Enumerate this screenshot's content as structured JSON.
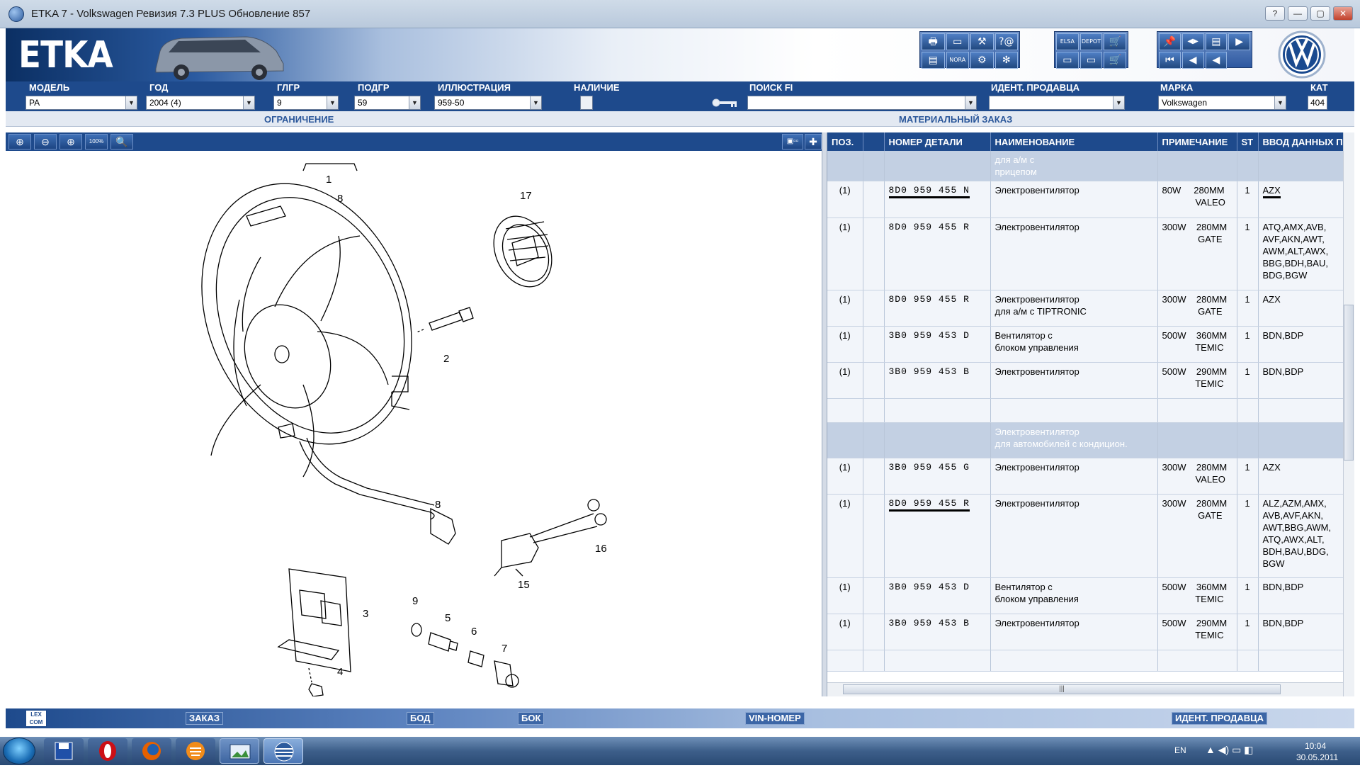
{
  "window": {
    "title": "ETKA 7 - Volkswagen Ревизия 7.3 PLUS Обновление 857",
    "buttons": [
      "?",
      "—",
      "▢",
      "✕"
    ]
  },
  "header": {
    "logo": "ETKA"
  },
  "toolbar_groups": [
    {
      "name": "print-search",
      "labels": [
        "🖶",
        "▭",
        "⚒",
        "?@",
        "▤",
        "NORA",
        "⚙",
        "✻"
      ]
    },
    {
      "name": "elsa-depot",
      "labels": [
        "ELSA",
        "DEPOT",
        "🛒",
        "▭",
        "▭",
        "🛒"
      ]
    },
    {
      "name": "navigation",
      "labels": [
        "📌",
        "◀▶",
        "▤",
        "▶",
        "⏮",
        "◀",
        "◀"
      ]
    }
  ],
  "fields": {
    "model": {
      "label": "МОДЕЛЬ",
      "value": "PA"
    },
    "year": {
      "label": "ГОД",
      "value": "2004 (4)"
    },
    "main_group": {
      "label": "ГЛГР",
      "value": "9"
    },
    "sub_group": {
      "label": "ПОДГР",
      "value": "59"
    },
    "illustration": {
      "label": "ИЛЛЮСТРАЦИЯ",
      "value": "959-50"
    },
    "availability": {
      "label": "НАЛИЧИЕ"
    },
    "search_fi": {
      "label": "ПОИСК FI",
      "value": ""
    },
    "dealer_id": {
      "label": "ИДЕНТ. ПРОДАВЦА",
      "value": ""
    },
    "brand": {
      "label": "МАРКА",
      "value": "Volkswagen"
    },
    "catalog": {
      "label": "КАТ",
      "value": "404"
    }
  },
  "sublabels": {
    "restriction": "ОГРАНИЧЕНИЕ",
    "material_order": "МАТЕРИАЛЬНЫЙ ЗАКАЗ"
  },
  "zoom_buttons": [
    "⊕",
    "⊖",
    "⊕",
    "100%",
    "🔍"
  ],
  "diagram_callouts": [
    "1",
    "8",
    "17",
    "2",
    "8",
    "16",
    "15",
    "3",
    "4",
    "9",
    "5",
    "6",
    "7"
  ],
  "parts_table": {
    "columns": [
      "ПОЗ.",
      "",
      "НОМЕР ДЕТАЛИ",
      "НАИМЕНОВАНИЕ",
      "ПРИМЕЧАНИЕ",
      "ST",
      "ВВОД ДАННЫХ П"
    ],
    "rows": [
      {
        "type": "header",
        "name": "для а/м с\nприцепом"
      },
      {
        "pos": "(1)",
        "part": "8D0  959  455  N",
        "name": "Электровентилятор",
        "note": "80W     280MM\n             VALEO",
        "st": "1",
        "data": "AZX",
        "ul_part": true,
        "ul_data": true
      },
      {
        "pos": "(1)",
        "part": "8D0  959  455  R",
        "name": "Электровентилятор",
        "note": "300W    280MM\n              GATE",
        "st": "1",
        "data": "ATQ,AMX,AVB,\nAVF,AKN,AWT,\nAWM,ALT,AWX,\nBBG,BDH,BAU,\nBDG,BGW"
      },
      {
        "pos": "(1)",
        "part": "8D0  959  455  R",
        "name": "Электровентилятор\nдля а/м с TIPTRONIC",
        "note": "300W    280MM\n              GATE",
        "st": "1",
        "data": "AZX"
      },
      {
        "pos": "(1)",
        "part": "3B0  959  453  D",
        "name": "Вентилятор с\nблоком управления",
        "note": "500W    360MM\n             TEMIC",
        "st": "1",
        "data": "BDN,BDP"
      },
      {
        "pos": "(1)",
        "part": "3B0  959  453  B",
        "name": "Электровентилятор",
        "note": "500W    290MM\n             TEMIC",
        "st": "1",
        "data": "BDN,BDP"
      },
      {
        "type": "empty"
      },
      {
        "type": "header",
        "name": "Электровентилятор\nдля автомобилей с кондицион."
      },
      {
        "pos": "(1)",
        "part": "3B0  959  455  G",
        "name": "Электровентилятор",
        "note": "300W    280MM\n             VALEO",
        "st": "1",
        "data": "AZX"
      },
      {
        "pos": "(1)",
        "part": "8D0  959  455  R",
        "name": "Электровентилятор",
        "note": "300W    280MM\n              GATE",
        "st": "1",
        "data": "ALZ,AZM,AMX,\nAVB,AVF,AKN,\nAWT,BBG,AWM,\nATQ,AWX,ALT,\nBDH,BAU,BDG,\nBGW",
        "ul_part": true
      },
      {
        "pos": "(1)",
        "part": "3B0  959  453  D",
        "name": "Вентилятор с\nблоком управления",
        "note": "500W    360MM\n             TEMIC",
        "st": "1",
        "data": "BDN,BDP"
      },
      {
        "pos": "(1)",
        "part": "3B0  959  453  B",
        "name": "Электровентилятор",
        "note": "500W    290MM\n             TEMIC",
        "st": "1",
        "data": "BDN,BDP"
      },
      {
        "type": "empty"
      }
    ]
  },
  "bottom_bar": {
    "order": "ЗАКАЗ",
    "bod": "БОД",
    "bok": "БОК",
    "vin": "VIN-НОМЕР",
    "dealer": "ИДЕНТ. ПРОДАВЦА",
    "lexcom": "LEX\nCOM"
  },
  "taskbar": {
    "lang": "EN",
    "time": "10:04",
    "date": "30.05.2011"
  }
}
